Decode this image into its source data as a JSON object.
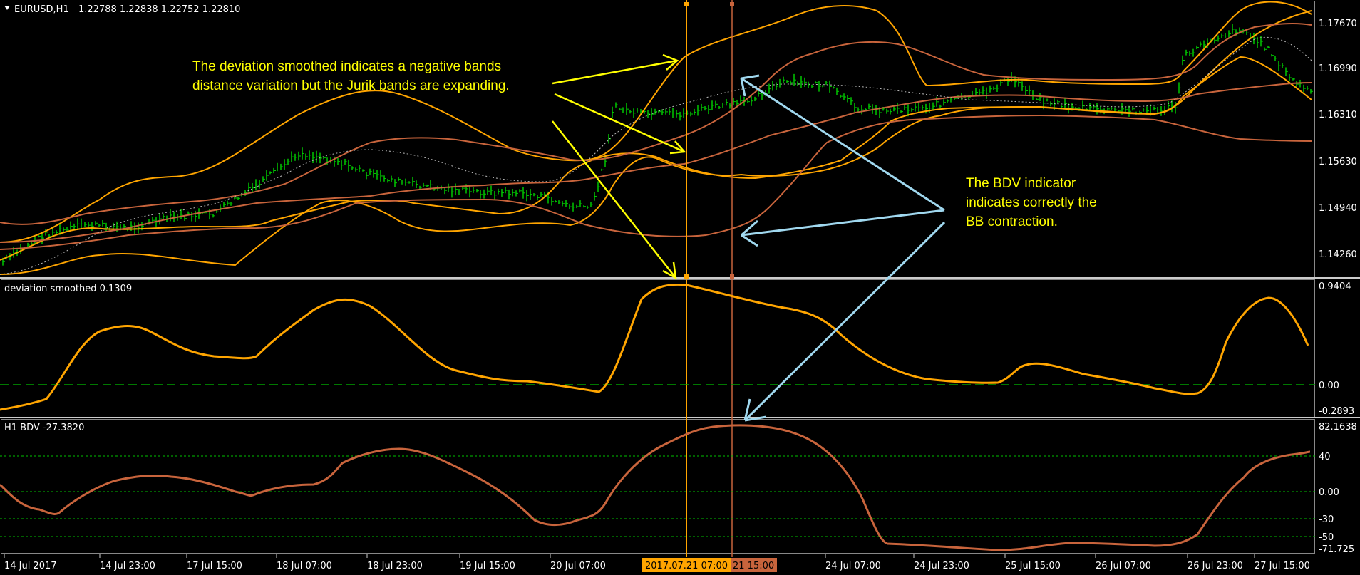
{
  "panels": {
    "main": {
      "symbol": "EURUSD,H1",
      "ohlc": "1.22788 1.22838 1.22752 1.22810",
      "price_levels": [
        "1.17670",
        "1.16990",
        "1.16310",
        "1.15630",
        "1.14940",
        "1.14260"
      ]
    },
    "dev": {
      "title": "deviation smoothed 0.1309",
      "levels": [
        "0.9404",
        "0.00",
        "-0.2893"
      ]
    },
    "bdv": {
      "title": "H1 BDV -27.3820",
      "levels": [
        "82.1638",
        "40",
        "0.00",
        "-30",
        "-50",
        "-71.725"
      ]
    }
  },
  "time_axis": {
    "labels": [
      "14 Jul 2017",
      "14 Jul 23:00",
      "17 Jul 15:00",
      "18 Jul 07:00",
      "18 Jul 23:00",
      "19 Jul 15:00",
      "20 Jul 07:00",
      "24 Jul 07:00",
      "24 Jul 23:00",
      "25 Jul 15:00",
      "26 Jul 07:00",
      "26 Jul 23:00",
      "27 Jul 15:00"
    ],
    "cursor1": "2017.07.21 07:00",
    "cursor2": "21 15:00",
    "cursor1_color": "#ffa500",
    "cursor2_color": "#c8643c"
  },
  "annotations": {
    "note1_line1": "The deviation smoothed indicates a negative bands",
    "note1_line2": "distance variation but the Jurik bands are expanding.",
    "note2_line1": "The BDV indicator",
    "note2_line2": "indicates correctly the",
    "note2_line3": "BB contraction."
  },
  "colors": {
    "background": "#000000",
    "bars": "#00c800",
    "jurik_bands": "#ffa500",
    "bollinger_bands": "#c8643c",
    "dev_line": "#ffa500",
    "bdv_line": "#c8643c",
    "zero_line": "#00a000",
    "arrow_yellow": "#ffff00",
    "arrow_blue": "#a0d8ef"
  }
}
